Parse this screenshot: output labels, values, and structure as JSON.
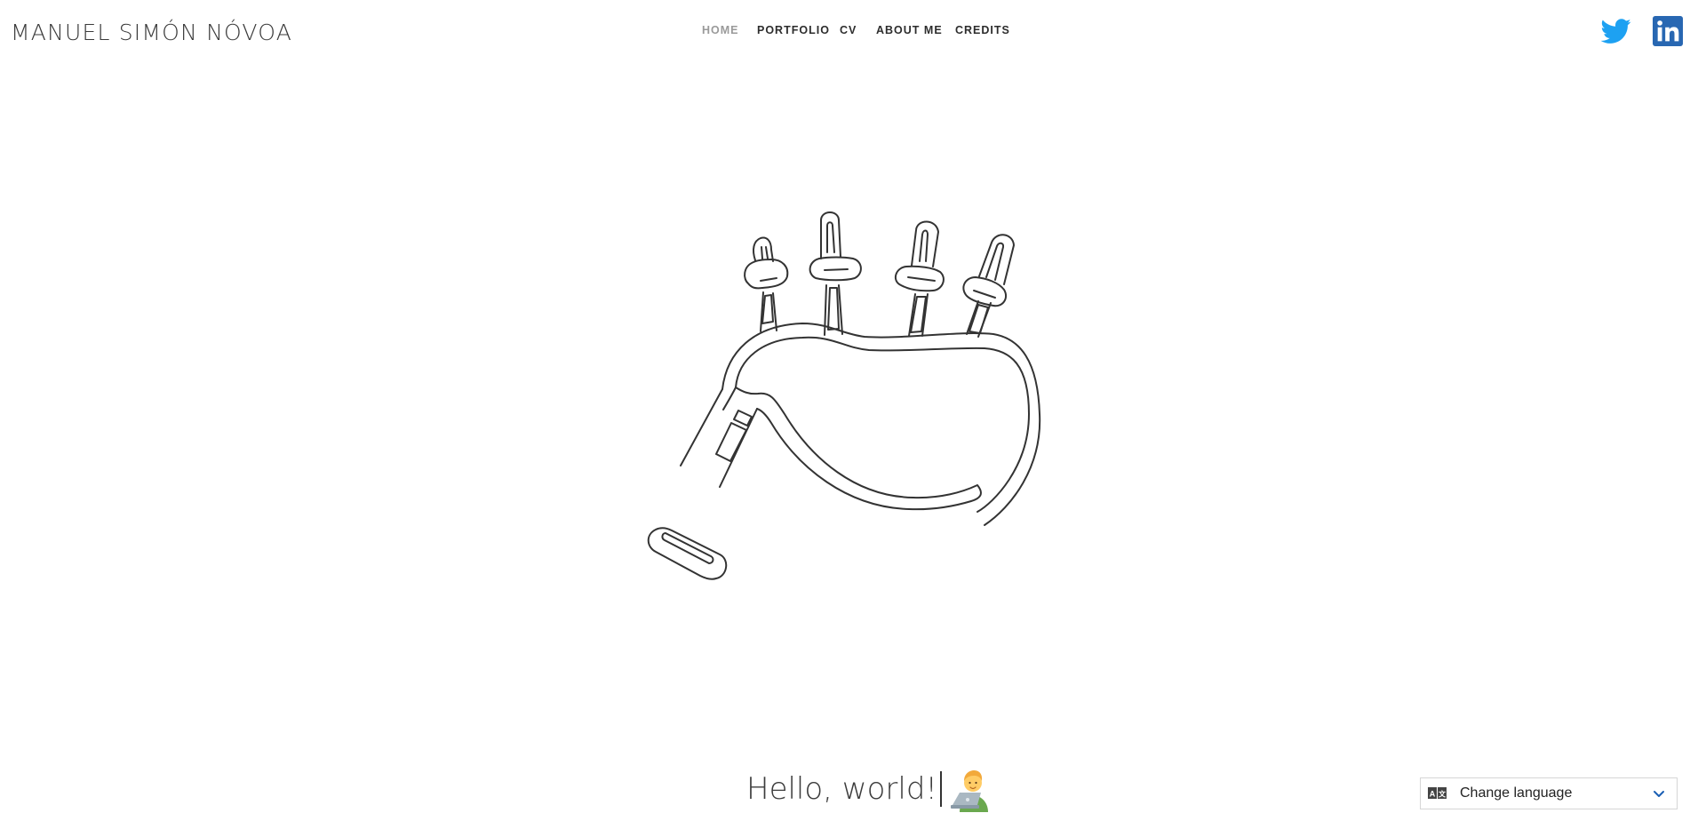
{
  "header": {
    "brand": "MANUEL SIMÓN NÓVOA",
    "nav": [
      {
        "label": "HOME",
        "active": true
      },
      {
        "label": "PORTFOLIO",
        "active": false
      },
      {
        "label": "CV",
        "active": false
      },
      {
        "label": "ABOUT ME",
        "active": false
      },
      {
        "label": "CREDITS",
        "active": false
      }
    ],
    "social": [
      {
        "icon": "twitter-icon",
        "color": "#1da1f2"
      },
      {
        "icon": "linkedin-icon",
        "color": "#2867b2"
      }
    ]
  },
  "hero": {
    "illustration": "bagpipes-icon"
  },
  "greeting": {
    "text": "Hello, world!",
    "emoji": "technologist-emoji"
  },
  "language": {
    "label": "Change language",
    "icon": "translate-icon"
  },
  "colors": {
    "nav_active": "#9a9a9a",
    "nav_text": "#2d2d2d",
    "twitter": "#1da1f2",
    "linkedin": "#2867b2"
  }
}
